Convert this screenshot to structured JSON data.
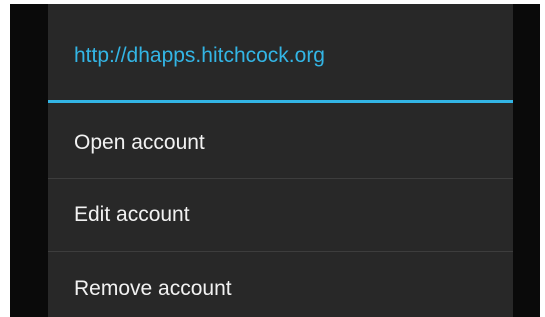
{
  "dialog": {
    "title": "http://dhapps.hitchcock.org",
    "items": [
      {
        "label": "Open account"
      },
      {
        "label": "Edit account"
      },
      {
        "label": "Remove account"
      }
    ]
  },
  "colors": {
    "accent": "#33b5e5",
    "dialog_background": "#282828",
    "screen_background": "#0a0a0a",
    "text": "#f2f2f2"
  }
}
